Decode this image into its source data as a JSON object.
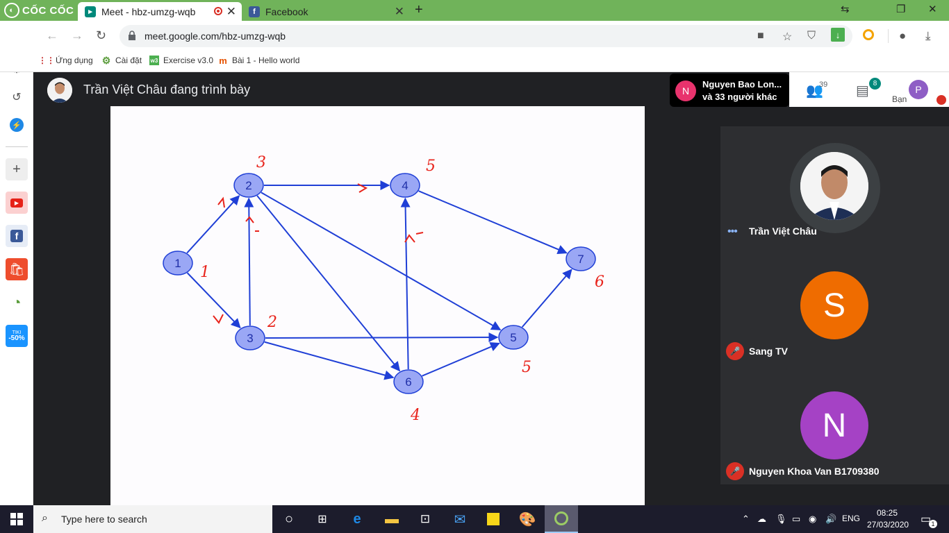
{
  "browser": {
    "brand_label": "CỐC CỐC",
    "tabs": [
      {
        "label": "Meet - hbz-umzg-wqb"
      },
      {
        "label": "Facebook"
      }
    ],
    "new_tab": "+",
    "url": "meet.google.com/hbz-umzg-wqb",
    "bookmarks": [
      {
        "label": "Ứng dụng"
      },
      {
        "label": "Cài đặt"
      },
      {
        "label": "Exercise v3.0"
      },
      {
        "label": "Bài 1 - Hello world"
      }
    ]
  },
  "sidebar": {
    "tiki_label_1": "TIKI",
    "tiki_label_2": "-50%"
  },
  "meet": {
    "presenter_title": "Trần Việt Châu đang trình bày",
    "others_avatar": "N",
    "others_line1": "Nguyen Bao Lon...",
    "others_line2": "và 33 người khác",
    "people_count": "39",
    "chat_count": "8",
    "me_label": "Bạn",
    "me_avatar": "P",
    "participants": [
      {
        "name": "Trần Việt Châu",
        "avatar": ""
      },
      {
        "name": "Sang TV",
        "avatar": "S",
        "color": "#ef6c00"
      },
      {
        "name": "Nguyen Khoa Van B1709380",
        "avatar": "N",
        "color": "#a542c5"
      }
    ]
  },
  "graph": {
    "nodes": [
      {
        "id": "1",
        "label": "1",
        "note": "1"
      },
      {
        "id": "2",
        "label": "2",
        "note": "3"
      },
      {
        "id": "3",
        "label": "3",
        "note": "2"
      },
      {
        "id": "4",
        "label": "4",
        "note": "5"
      },
      {
        "id": "5",
        "label": "5",
        "note": "5"
      },
      {
        "id": "6",
        "label": "6",
        "note": "4"
      },
      {
        "id": "7",
        "label": "7",
        "note": "6"
      }
    ],
    "edges": [
      [
        "1",
        "2"
      ],
      [
        "1",
        "3"
      ],
      [
        "2",
        "4"
      ],
      [
        "2",
        "5"
      ],
      [
        "2",
        "6"
      ],
      [
        "3",
        "2"
      ],
      [
        "3",
        "5"
      ],
      [
        "3",
        "6"
      ],
      [
        "4",
        "7"
      ],
      [
        "5",
        "7"
      ],
      [
        "6",
        "4"
      ],
      [
        "6",
        "5"
      ]
    ]
  },
  "taskbar": {
    "search_placeholder": "Type here to search",
    "lang": "ENG",
    "time": "08:25",
    "date": "27/03/2020",
    "notif_count": "1"
  }
}
